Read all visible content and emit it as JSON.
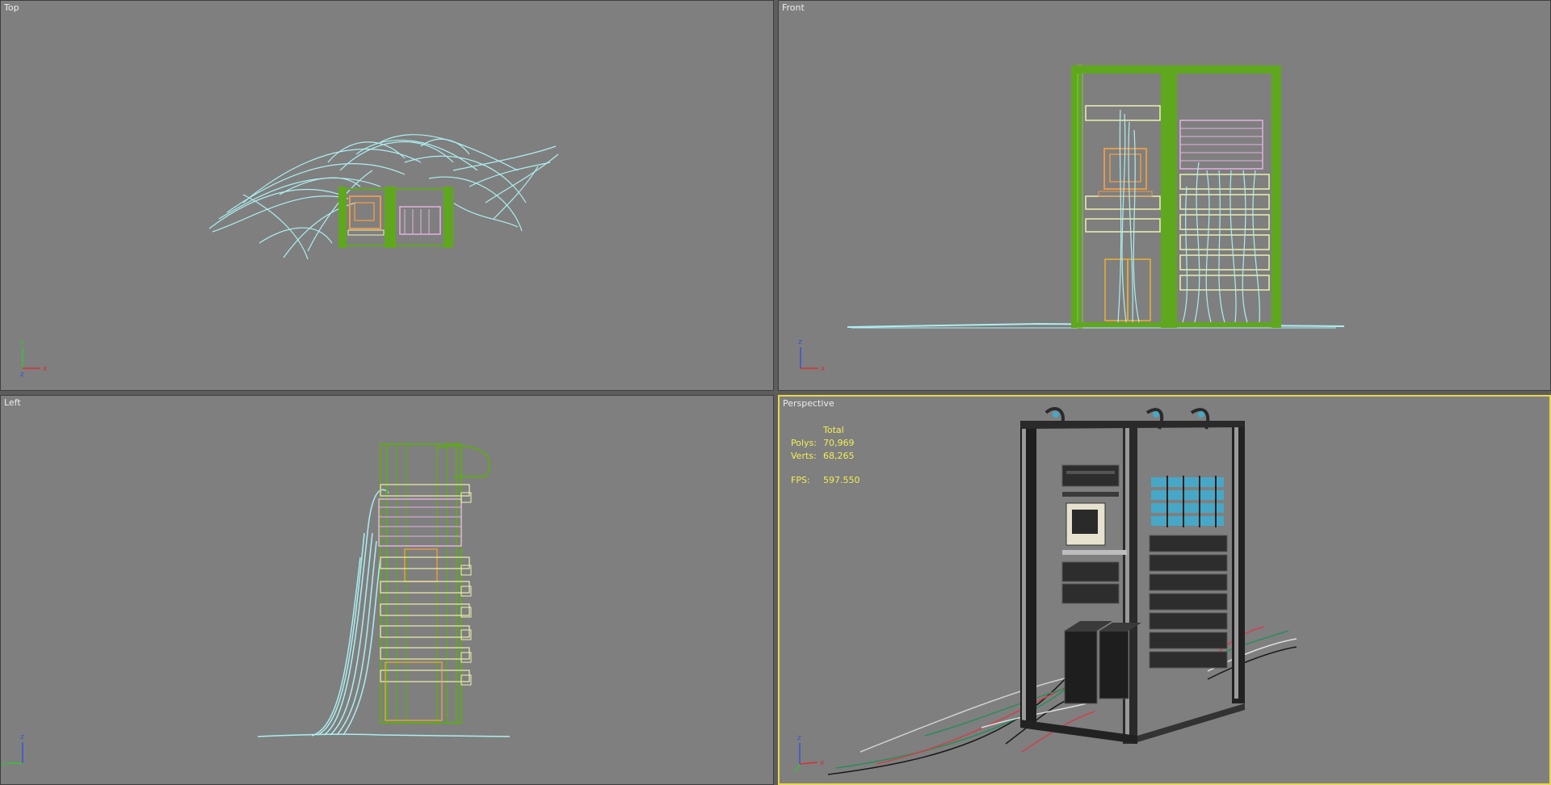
{
  "viewports": {
    "top": {
      "label": "Top",
      "axis": [
        "y",
        "x",
        "z"
      ]
    },
    "front": {
      "label": "Front",
      "axis": [
        "z",
        "x"
      ]
    },
    "left": {
      "label": "Left",
      "axis": [
        "z",
        "y"
      ]
    },
    "perspective": {
      "label": "Perspective",
      "axis": [
        "z",
        "x"
      ],
      "stats": {
        "header": "Total",
        "polys_label": "Polys:",
        "polys_value": "70,969",
        "verts_label": "Verts:",
        "verts_value": "68,265",
        "fps_label": "FPS:",
        "fps_value": "597.550"
      }
    }
  },
  "colors": {
    "background": "#7f7f7f",
    "active_border": "#e8d84a",
    "wire_green": "#5fa81e",
    "wire_cyan": "#aeeef0",
    "wire_orange": "#e49a4c",
    "wire_pink": "#e4b0e0",
    "wire_yellow": "#eef0b0",
    "stats_text": "#f2ef52"
  }
}
